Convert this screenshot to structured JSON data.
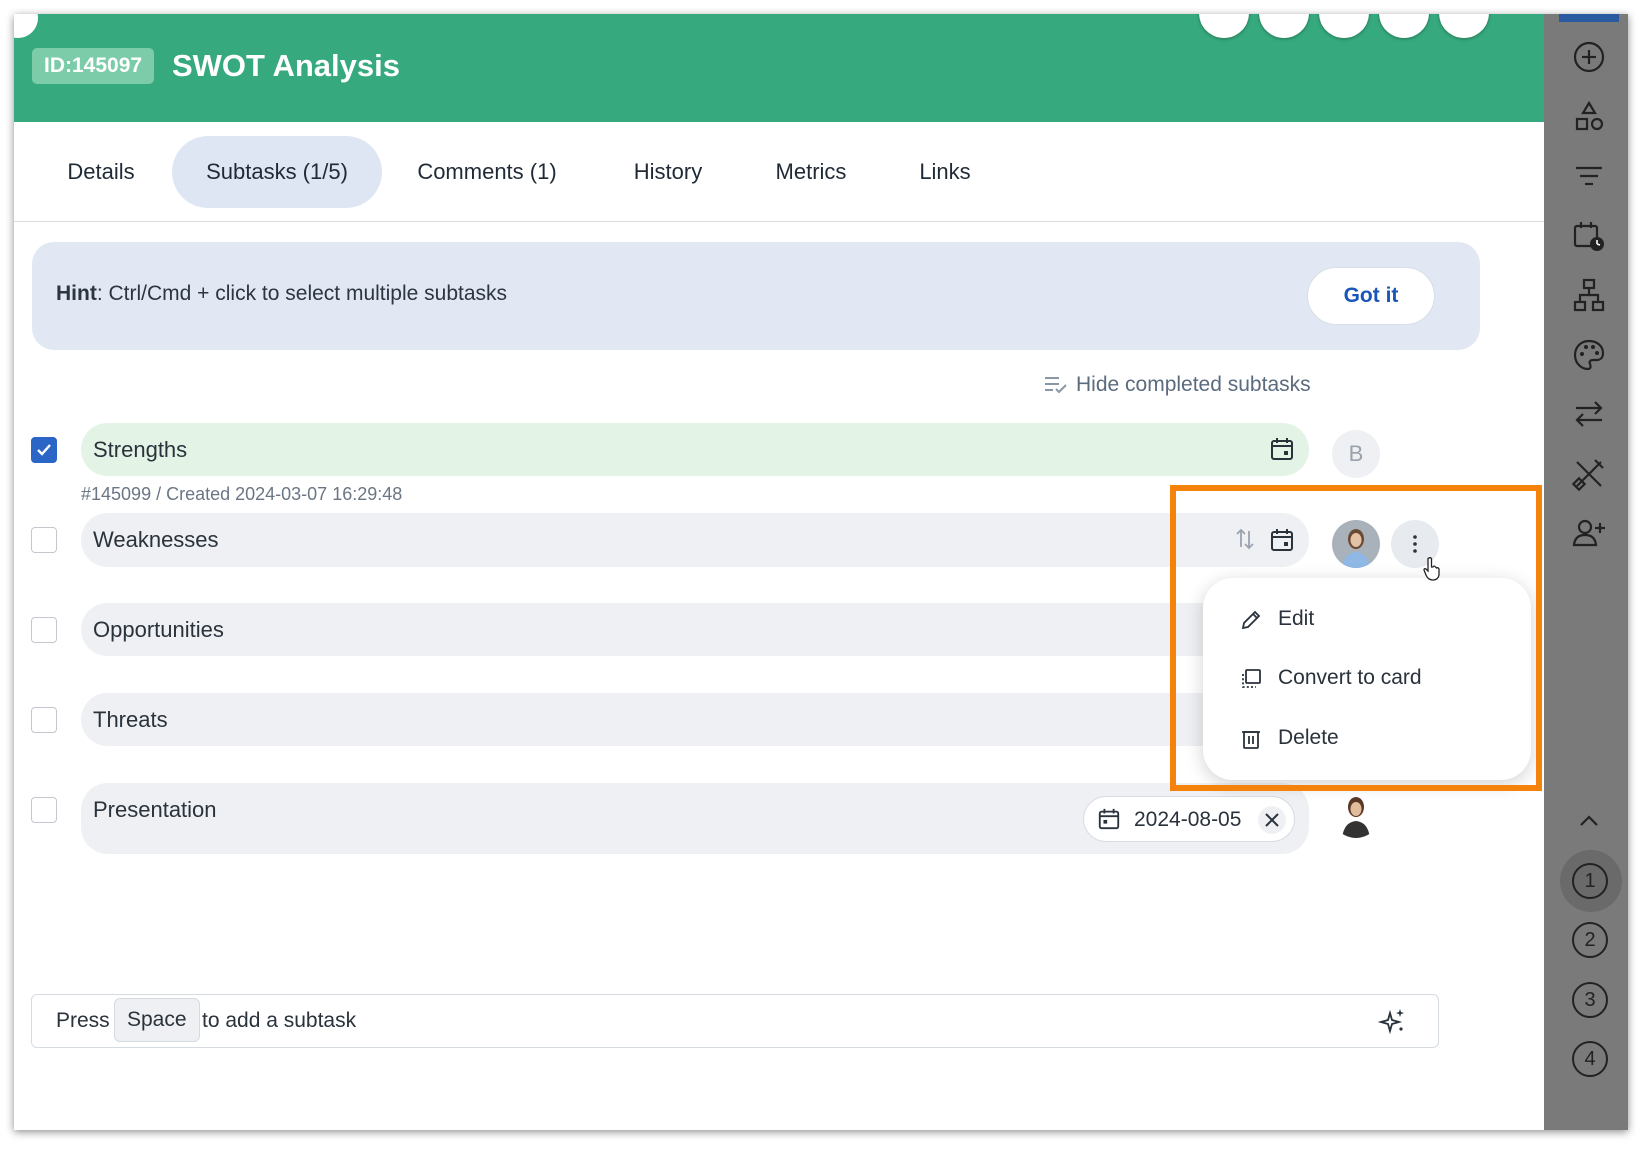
{
  "card": {
    "id_badge": "ID:145097",
    "title": "SWOT Analysis"
  },
  "tabs": [
    {
      "label": "Details"
    },
    {
      "label": "Subtasks (1/5)"
    },
    {
      "label": "Comments (1)"
    },
    {
      "label": "History"
    },
    {
      "label": "Metrics"
    },
    {
      "label": "Links"
    }
  ],
  "hint": {
    "bold": "Hint",
    "text": ": Ctrl/Cmd + click to select multiple subtasks",
    "button": "Got it"
  },
  "hide_completed_label": "Hide completed subtasks",
  "subtasks": [
    {
      "label": "Strengths",
      "checked": true,
      "assignee_initial": "B",
      "meta": "#145099 / Created 2024-03-07 16:29:48"
    },
    {
      "label": "Weaknesses",
      "checked": false
    },
    {
      "label": "Opportunities",
      "checked": false
    },
    {
      "label": "Threats",
      "checked": false
    },
    {
      "label": "Presentation",
      "checked": false,
      "due_date": "2024-08-05"
    }
  ],
  "context_menu": {
    "items": [
      {
        "label": "Edit",
        "icon": "pencil-icon"
      },
      {
        "label": "Convert to card",
        "icon": "convert-card-icon"
      },
      {
        "label": "Delete",
        "icon": "trash-icon"
      }
    ]
  },
  "add_subtask": {
    "press": "Press",
    "key": "Space",
    "suffix": "to add a subtask"
  },
  "sidebar": {
    "icons": [
      "add-circle-icon",
      "shapes-icon",
      "filter-icon",
      "calendar-clock-icon",
      "hierarchy-icon",
      "palette-icon",
      "swap-icon",
      "tools-icon",
      "add-user-icon",
      "chevron-up-icon"
    ],
    "numbers": [
      "1",
      "2",
      "3",
      "4"
    ]
  },
  "colors": {
    "header": "#36a97e",
    "accent": "#1a56b8",
    "highlight": "#f4820b",
    "sidebar": "#7a7a7a"
  }
}
